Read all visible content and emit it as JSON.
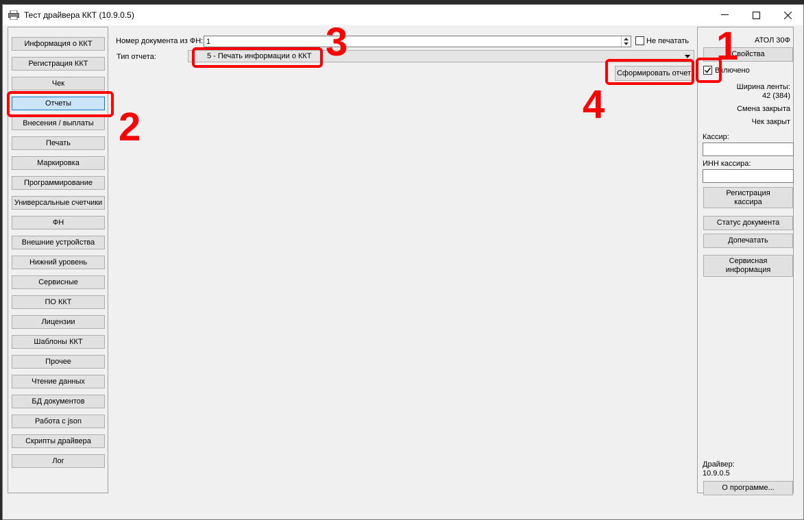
{
  "window": {
    "title": "Тест драйвера ККТ (10.9.0.5)",
    "minimize": "—",
    "maximize": "☐",
    "close": "✕"
  },
  "nav": {
    "items": [
      "Информация о ККТ",
      "Регистрация ККТ",
      "Чек",
      "Отчеты",
      "Внесения / выплаты",
      "Печать",
      "Маркировка",
      "Программирование",
      "Универсальные счетчики",
      "ФН",
      "Внешние устройства",
      "Нижний уровень",
      "Сервисные",
      "ПО ККТ",
      "Лицензии",
      "Шаблоны ККТ",
      "Прочее",
      "Чтение данных",
      "БД документов",
      "Работа с json",
      "Скрипты драйвера",
      "Лог"
    ],
    "active": "Отчеты"
  },
  "main": {
    "doc_number_label": "Номер документа из ФН:",
    "doc_number_value": "1",
    "no_print_label": "Не печатать",
    "no_print_checked": false,
    "report_type_label": "Тип отчета:",
    "report_type_value": "5 - Печать информации о ККТ",
    "generate_button": "Сформировать отчет"
  },
  "right": {
    "device_name": "АТОЛ 30Ф",
    "properties_button": "Свойства",
    "enabled_label": "Включено",
    "enabled_checked": true,
    "tape_width_label": "Ширина ленты:",
    "tape_width_value": "42 (384)",
    "shift_status": "Смена закрыта",
    "receipt_status": "Чек закрыт",
    "cashier_label": "Кассир:",
    "cashier_value": "",
    "cashier_inn_label": "ИНН кассира:",
    "cashier_inn_value": "",
    "register_cashier_button_line1": "Регистрация",
    "register_cashier_button_line2": "кассира",
    "doc_status_button": "Статус документа",
    "reprint_button": "Допечатать",
    "service_info_button_line1": "Сервисная",
    "service_info_button_line2": "информация",
    "driver_label": "Драйвер:",
    "driver_version": "10.9.0.5",
    "about_button": "О программе..."
  },
  "annotations": {
    "n1": "1",
    "n2": "2",
    "n3": "3",
    "n4": "4",
    "color": "#ff0000"
  },
  "icons": {
    "app": "printer-icon",
    "check": "checkmark-icon",
    "dropdown": "dropdown-arrow-icon"
  }
}
